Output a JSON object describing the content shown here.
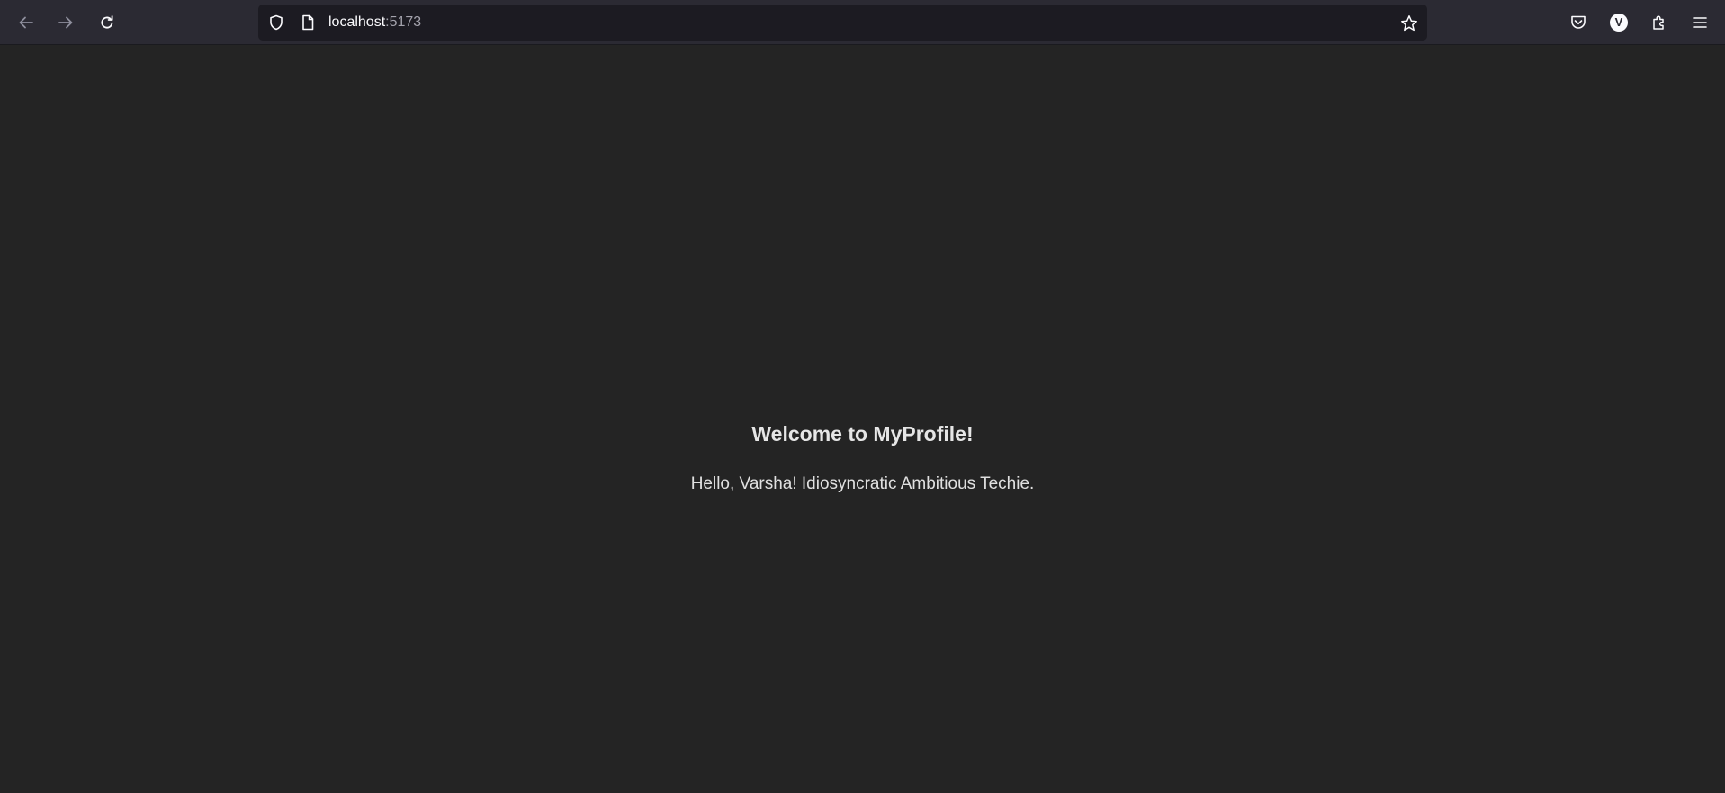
{
  "browser": {
    "url_host": "localhost",
    "url_port": ":5173",
    "profile_initial": "V",
    "icons": {
      "back": "arrow-left-icon",
      "forward": "arrow-right-icon",
      "reload": "reload-icon",
      "shield": "tracking-protection-shield-icon",
      "page": "page-info-icon",
      "bookmark": "star-icon",
      "pocket": "pocket-icon",
      "extensions": "puzzle-icon",
      "menu": "hamburger-menu-icon"
    },
    "colors": {
      "toolbar": "#2b2a33",
      "urlbar": "#1c1b22",
      "page_background": "#242424"
    }
  },
  "page": {
    "heading": "Welcome to MyProfile!",
    "greeting": "Hello, Varsha! Idiosyncratic Ambitious Techie."
  }
}
